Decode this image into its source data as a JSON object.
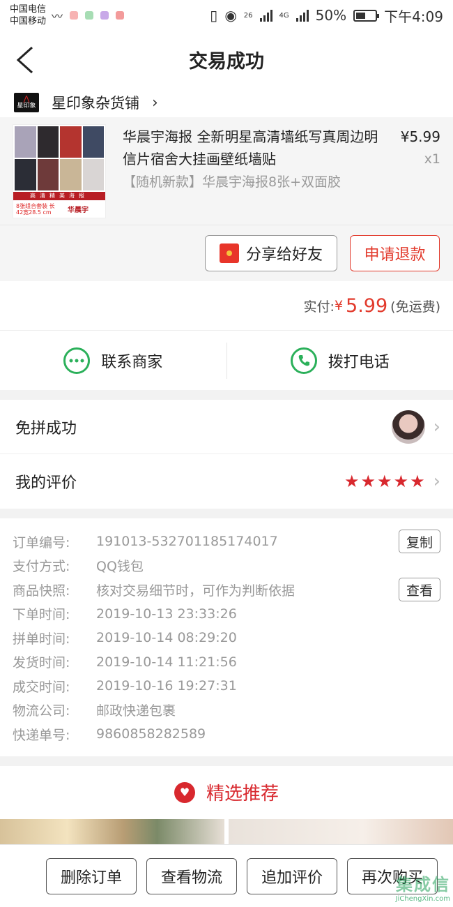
{
  "status_bar": {
    "carrier1": "中国电信",
    "carrier2": "中国移动",
    "net1": "26",
    "net2": "4G",
    "battery": "50%",
    "battery_level": 0.5,
    "time": "下午4:09"
  },
  "header": {
    "title": "交易成功"
  },
  "shop": {
    "logo_text": "星印象",
    "name": "星印象杂货铺",
    "chevron": "›"
  },
  "product": {
    "thumb_strip": "高清精美海报",
    "thumb_left": "8张组合套装 长42宽28.5 cm",
    "thumb_name": "华晨宇",
    "title": "华晨宇海报 全新明星高清墙纸写真周边明信片宿舍大挂画壁纸墙贴",
    "price": "¥5.99",
    "qty": "x1",
    "spec": "【随机新款】华晨宇海报8张+双面胶"
  },
  "order_actions": {
    "share_label": "分享给好友",
    "refund_label": "申请退款"
  },
  "payment": {
    "label": "实付:",
    "currency": "¥",
    "amount": "5.99",
    "shipping": "(免运费)"
  },
  "contact": {
    "merchant_label": "联系商家",
    "call_label": "拨打电话"
  },
  "status_rows": {
    "group_label": "免拼成功",
    "review_label": "我的评价",
    "stars": [
      "★",
      "★",
      "★",
      "★",
      "★"
    ]
  },
  "details": [
    {
      "label": "订单编号:",
      "value": "191013-532701185174017",
      "button": "复制"
    },
    {
      "label": "支付方式:",
      "value": "QQ钱包"
    },
    {
      "label": "商品快照:",
      "value": "核对交易细节时，可作为判断依据",
      "button": "查看"
    },
    {
      "label": "下单时间:",
      "value": "2019-10-13 23:33:26"
    },
    {
      "label": "拼单时间:",
      "value": "2019-10-14 08:29:20"
    },
    {
      "label": "发货时间:",
      "value": "2019-10-14 11:21:56"
    },
    {
      "label": "成交时间:",
      "value": "2019-10-16 19:27:31"
    },
    {
      "label": "物流公司:",
      "value": "邮政快递包裹"
    },
    {
      "label": "快递单号:",
      "value": "9860858282589"
    }
  ],
  "recommend": {
    "title": "精选推荐"
  },
  "bottom_bar": {
    "delete_label": "删除订单",
    "logistics_label": "查看物流",
    "review_label": "追加评价",
    "rebuy_label": "再次购买"
  },
  "watermark": {
    "logo": "集成信",
    "sub": "JiChengXin.com"
  },
  "colors": {
    "accent_red": "#e23a2c",
    "green": "#2bb05a",
    "star_red": "#d8282e"
  }
}
